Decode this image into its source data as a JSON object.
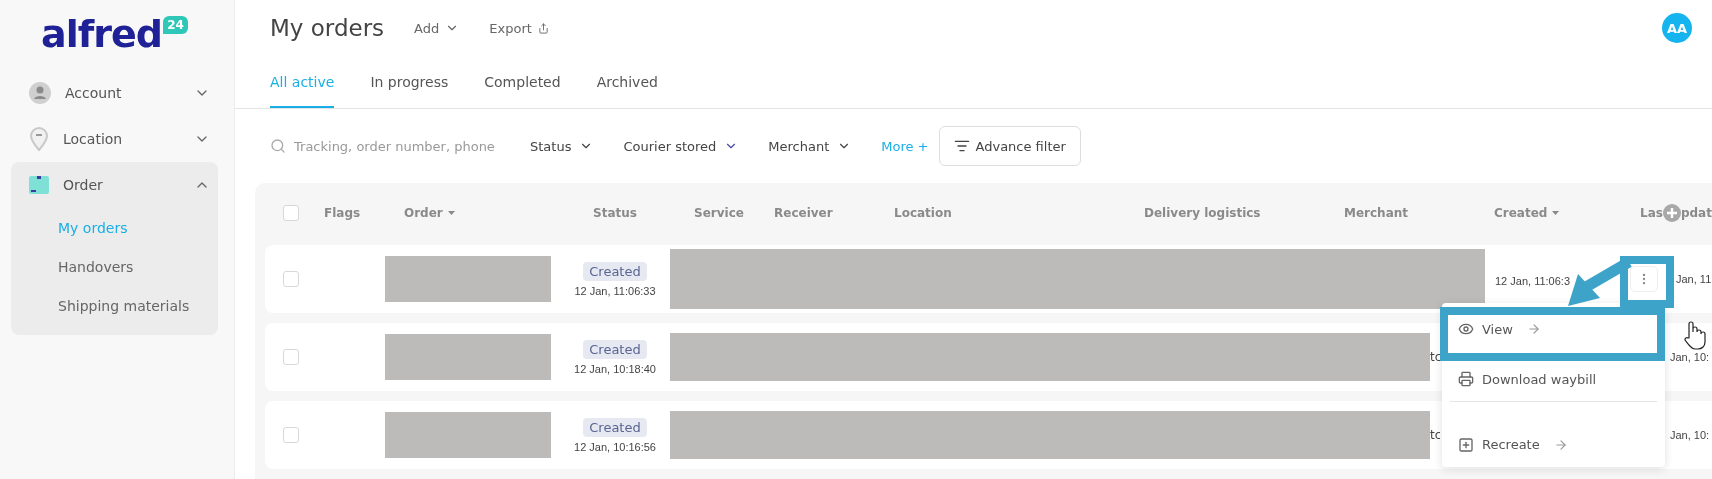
{
  "sidebar": {
    "logo": {
      "text": "alfred",
      "badge": "24"
    },
    "items": [
      {
        "label": "Account",
        "kind": "account",
        "expanded": false
      },
      {
        "label": "Location",
        "kind": "location",
        "expanded": false
      },
      {
        "label": "Order",
        "kind": "order",
        "expanded": true,
        "children": [
          {
            "label": "My orders",
            "selected": true
          },
          {
            "label": "Handovers",
            "selected": false
          },
          {
            "label": "Shipping materials",
            "selected": false
          }
        ]
      }
    ]
  },
  "header": {
    "title": "My orders",
    "actions": [
      {
        "label": "Add",
        "kind": "dropdown"
      },
      {
        "label": "Export",
        "kind": "export"
      }
    ],
    "avatar": "AA"
  },
  "tabs": [
    {
      "label": "All active",
      "selected": true
    },
    {
      "label": "In progress",
      "selected": false
    },
    {
      "label": "Completed",
      "selected": false
    },
    {
      "label": "Archived",
      "selected": false
    }
  ],
  "filters": {
    "search": {
      "placeholder": "Tracking, order number, phone"
    },
    "dropdowns": [
      {
        "label": "Status"
      },
      {
        "label": "Courier stored"
      },
      {
        "label": "Merchant"
      }
    ],
    "more": "More +",
    "advance": "Advance filter"
  },
  "table": {
    "select_all_checked": false,
    "columns": [
      {
        "label": "Flags",
        "sortable": false
      },
      {
        "label": "Order",
        "sortable": true
      },
      {
        "label": "Status",
        "sortable": false
      },
      {
        "label": "Service",
        "sortable": false
      },
      {
        "label": "Receiver",
        "sortable": false
      },
      {
        "label": "Location",
        "sortable": false
      },
      {
        "label": "Delivery logistics",
        "sortable": false
      },
      {
        "label": "Merchant",
        "sortable": false
      },
      {
        "label": "Created",
        "sortable": true
      },
      {
        "label_start": "Las",
        "label_end": "pdat"
      }
    ],
    "rows": [
      {
        "checked": false,
        "status": "Created",
        "status_time": "12 Jan, 11:06:33",
        "created": "12 Jan, 11:06:3",
        "updated": "Jan, 11",
        "menu_open": true
      },
      {
        "checked": false,
        "status": "Created",
        "status_time": "12 Jan, 10:18:40",
        "merchant_fragment": "tc",
        "updated": "Jan, 10:",
        "menu_open": false
      },
      {
        "checked": false,
        "status": "Created",
        "status_time": "12 Jan, 10:16:56",
        "merchant_fragment": "tc",
        "updated": "Jan, 10:",
        "menu_open": false
      }
    ]
  },
  "row_menu": {
    "items": [
      {
        "label": "View",
        "kind": "view",
        "arrow": true
      },
      {
        "label": "Download waybill",
        "kind": "print",
        "arrow": false
      },
      {
        "label": "Recreate",
        "kind": "recreate",
        "arrow": true
      }
    ]
  }
}
